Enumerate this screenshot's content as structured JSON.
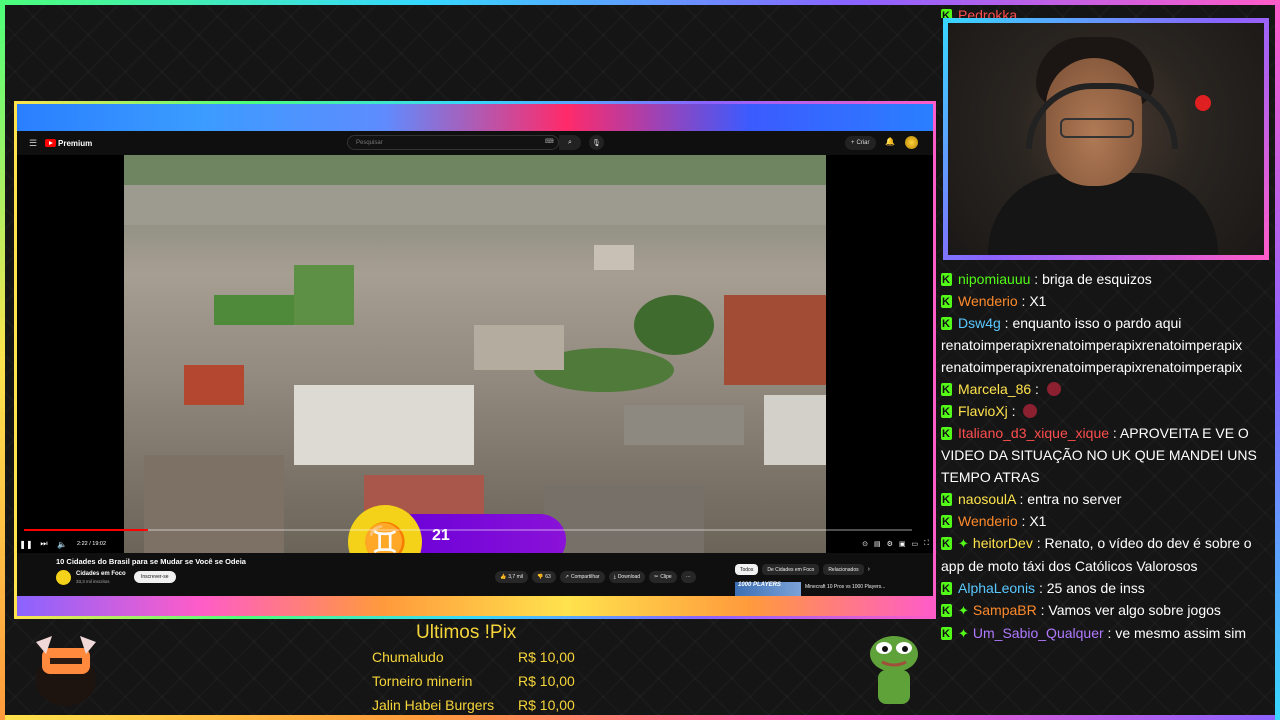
{
  "youtube": {
    "logo_text": "Premium",
    "search_placeholder": "Pesquisar",
    "create_label": "Criar",
    "video_title": "10 Cidades do Brasil para se Mudar se Você se Odeia",
    "time": "2:22 / 19:02",
    "progress_fraction": 0.14,
    "channel_name": "Cidades em Foco",
    "channel_subs": "33,3 mil inscritos",
    "subscribe_label": "Inscrever-se",
    "likes": "3,7 mil",
    "comments": "63",
    "share_label": "Compartilhar",
    "download_label": "Download",
    "clip_label": "Clipe",
    "more_label": "···",
    "chips": [
      "Todos",
      "De Cidades em Foco",
      "Relacionados"
    ],
    "rec_thumb_text": "1000 PLAYERS",
    "rec_title": "Minecraft 10 Pros vs 1000 Players..."
  },
  "overlay_badge": {
    "number": "21"
  },
  "chat": {
    "top_partial": {
      "user": "Pedrokka"
    },
    "messages": [
      {
        "user": "nipomiauuu",
        "color": "#53fc18",
        "text": "briga de esquizos"
      },
      {
        "user": "Wenderio",
        "color": "#ff8a2a",
        "text": "X1"
      },
      {
        "user": "Dsw4g",
        "color": "#5ac8ff",
        "text": "enquanto isso o pardo aqui renatoimperapixrenatoimperapixrenatoimperapix renatoimperapixrenatoimperapixrenatoimperapix"
      },
      {
        "user": "Marcela_86",
        "color": "#ffe34d",
        "text": ""
      },
      {
        "user": "FlavioXj",
        "color": "#ffe34d",
        "text": ""
      },
      {
        "user": "Italiano_d3_xique_xique",
        "color": "#ff4d4d",
        "text": "APROVEITA E VE O VIDEO DA SITUAÇÃO NO UK QUE MANDEI UNS TEMPO ATRAS"
      },
      {
        "user": "naosoulA",
        "color": "#ffe34d",
        "text": "entra no server"
      },
      {
        "user": "Wenderio",
        "color": "#ff8a2a",
        "text": "X1"
      },
      {
        "user": "heitorDev",
        "color": "#ffe34d",
        "text": "Renato, o vídeo do dev é sobre o app de moto táxi dos Católicos Valorosos",
        "badge": true
      },
      {
        "user": "AlphaLeonis",
        "color": "#5ac8ff",
        "text": "25 anos de inss"
      },
      {
        "user": "SampaBR",
        "color": "#ff8a2a",
        "text": "Vamos ver algo sobre jogos",
        "badge": true
      },
      {
        "user": "Um_Sabio_Qualquer",
        "color": "#b07aff",
        "text": "ve mesmo assim sim",
        "badge": true
      }
    ]
  },
  "pix": {
    "title": "Ultimos !Pix",
    "entries": [
      {
        "name": "Chumaludo",
        "amount": "R$ 10,00"
      },
      {
        "name": "Torneiro minerin",
        "amount": "R$ 10,00"
      },
      {
        "name": "Jalin Habei Burgers",
        "amount": "R$ 10,00"
      }
    ]
  },
  "icons": {
    "menu": "hamburger-icon",
    "search": "search-icon",
    "mic": "mic-icon",
    "bell": "bell-icon",
    "play": "pause-icon",
    "kick_badge": "kick-icon"
  }
}
